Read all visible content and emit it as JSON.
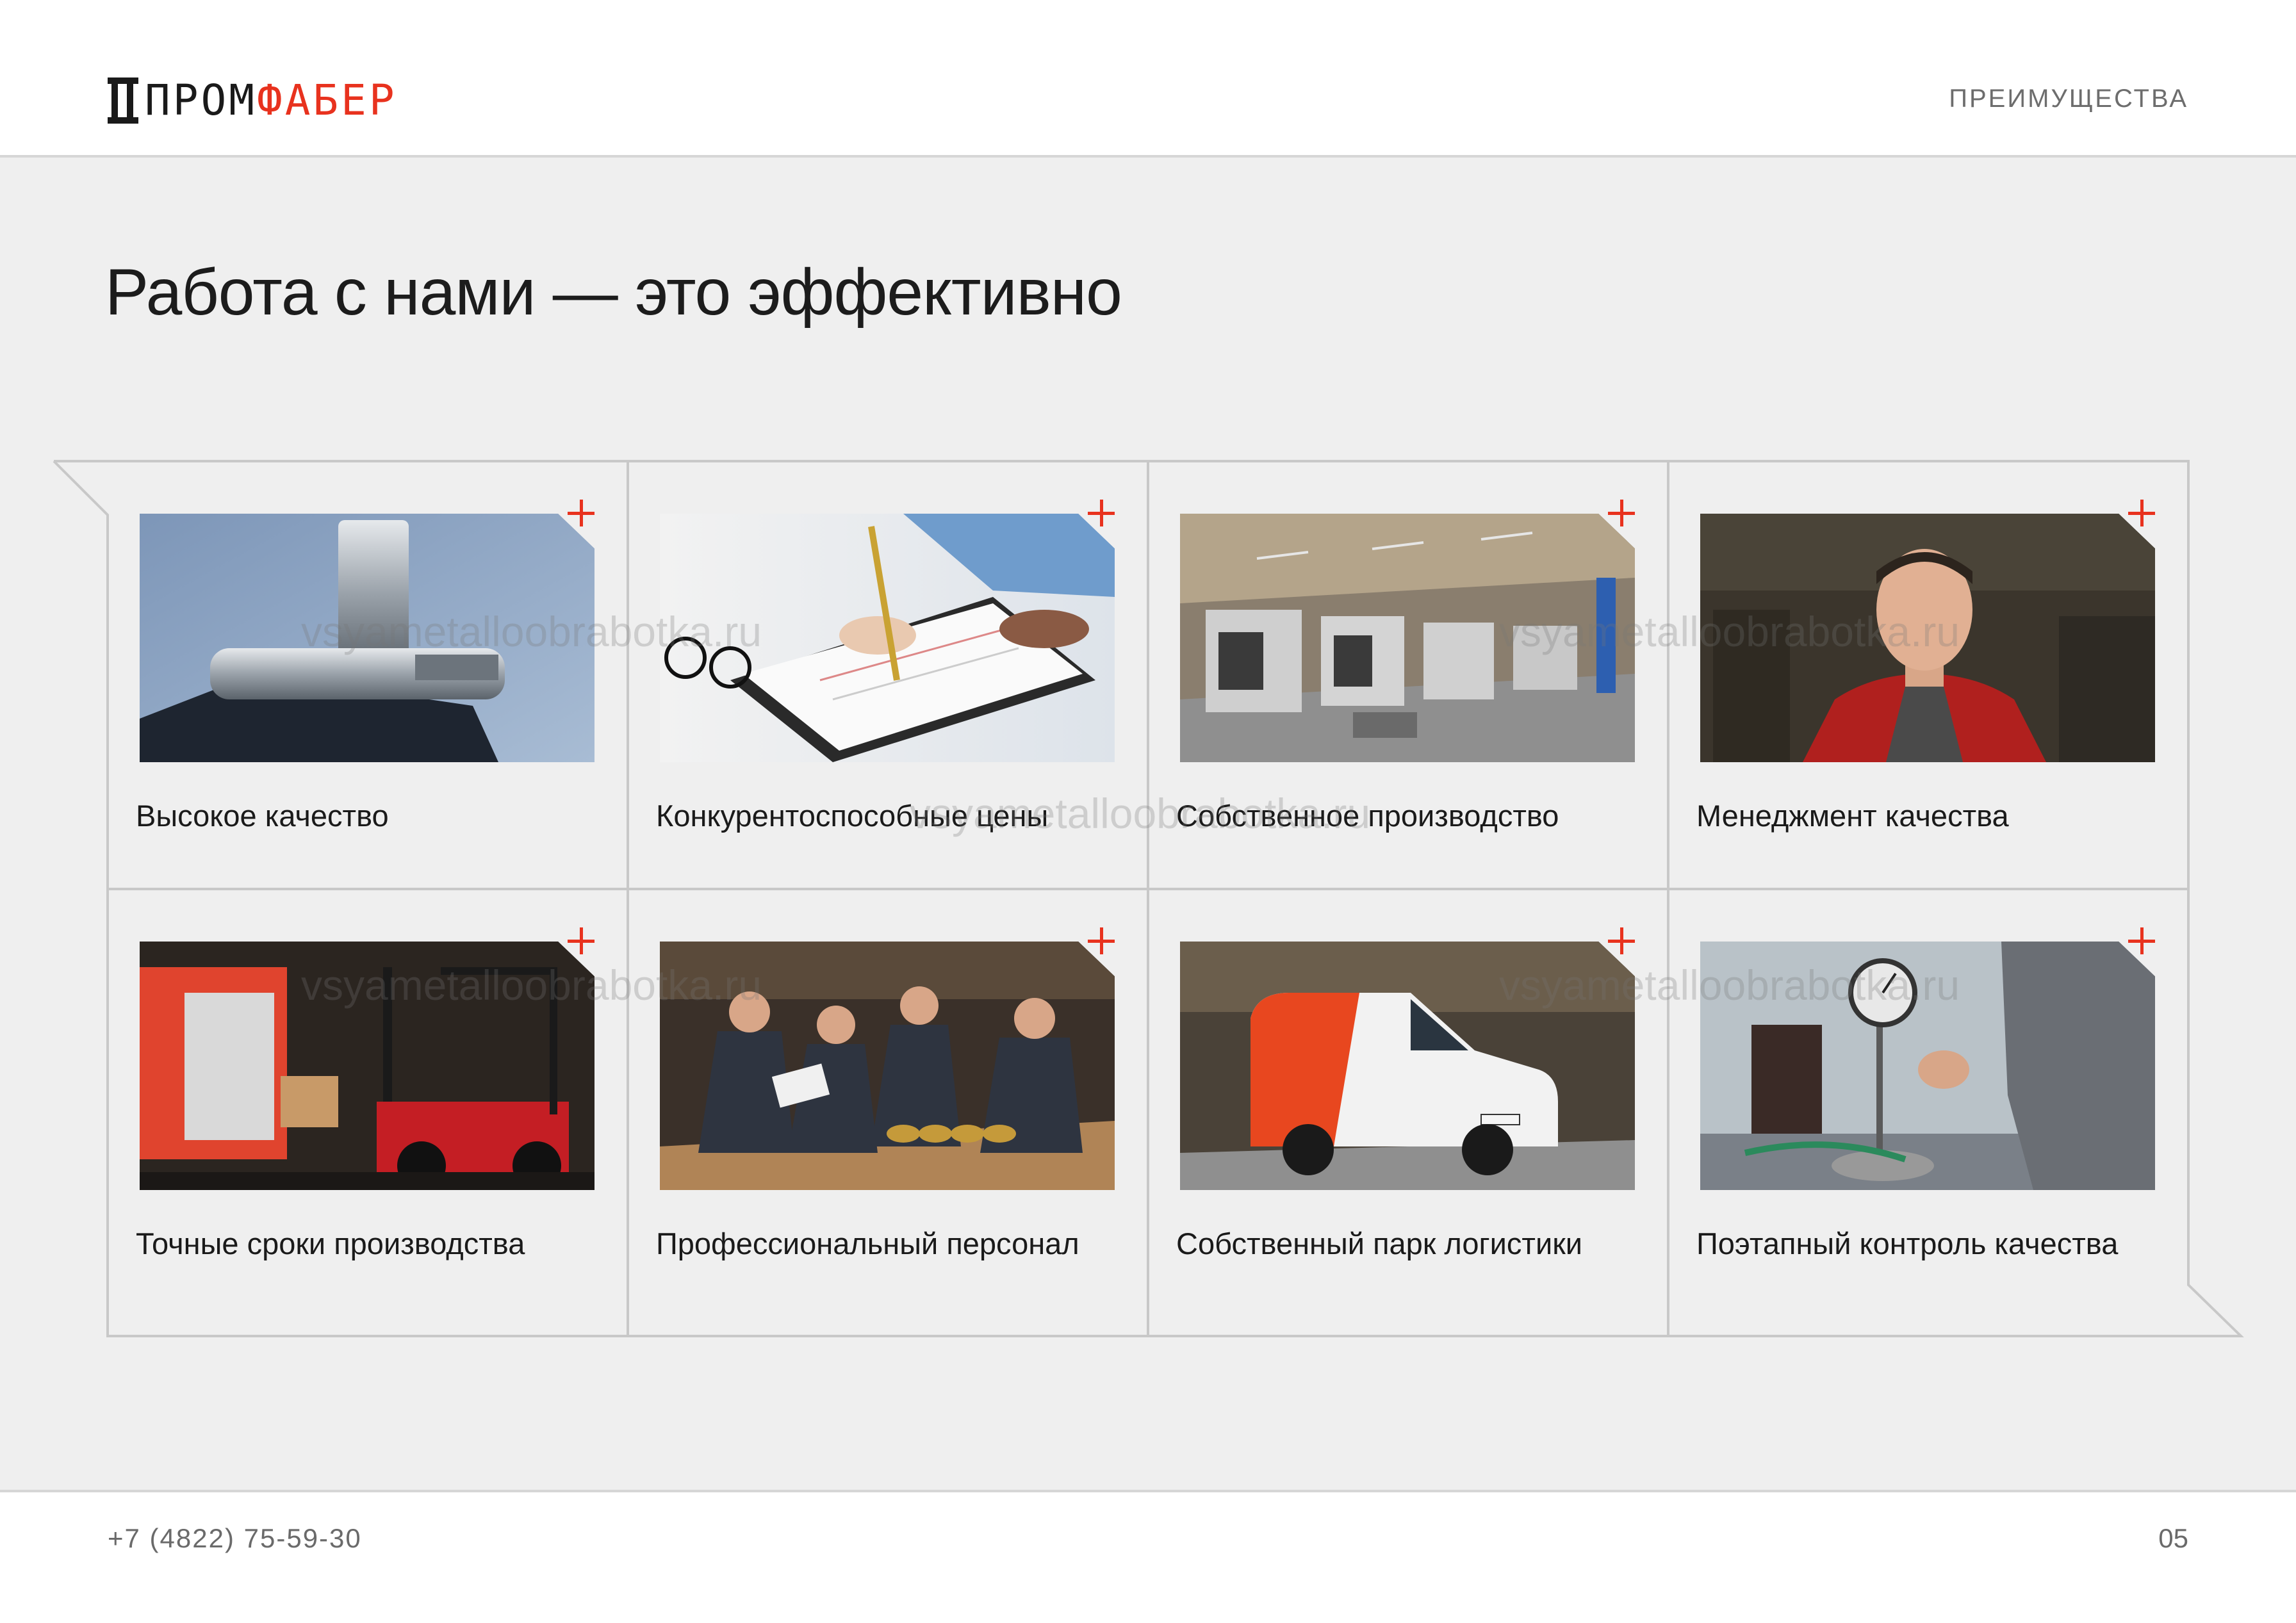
{
  "header": {
    "logo_part1": "ПРОМ",
    "logo_part2": "ФАБЕР",
    "section": "ПРЕИМУЩЕСТВА"
  },
  "main": {
    "title": "Работа с нами — это эффективно",
    "cards": [
      {
        "label": "Высокое качество",
        "photo": "machined-metal-part"
      },
      {
        "label": "Конкурентоспособные цены",
        "photo": "signing-document"
      },
      {
        "label": "Собственное производство",
        "photo": "factory-floor"
      },
      {
        "label": "Менеджмент качества",
        "photo": "worker-portrait"
      },
      {
        "label": "Точные сроки производства",
        "photo": "forklift-loading-van"
      },
      {
        "label": "Профессиональный персонал",
        "photo": "team-at-table"
      },
      {
        "label": "Собственный парк логистики",
        "photo": "company-van"
      },
      {
        "label": "Поэтапный контроль качества",
        "photo": "measuring-gauge"
      }
    ]
  },
  "watermark": "vsyametalloobrabotka.ru",
  "footer": {
    "phone": "+7 (4822) 75-59-30",
    "page_number": "05"
  },
  "colors": {
    "accent": "#e8321e",
    "background": "#efefef",
    "text": "#1a1a1a",
    "muted": "#6d6d6d"
  }
}
